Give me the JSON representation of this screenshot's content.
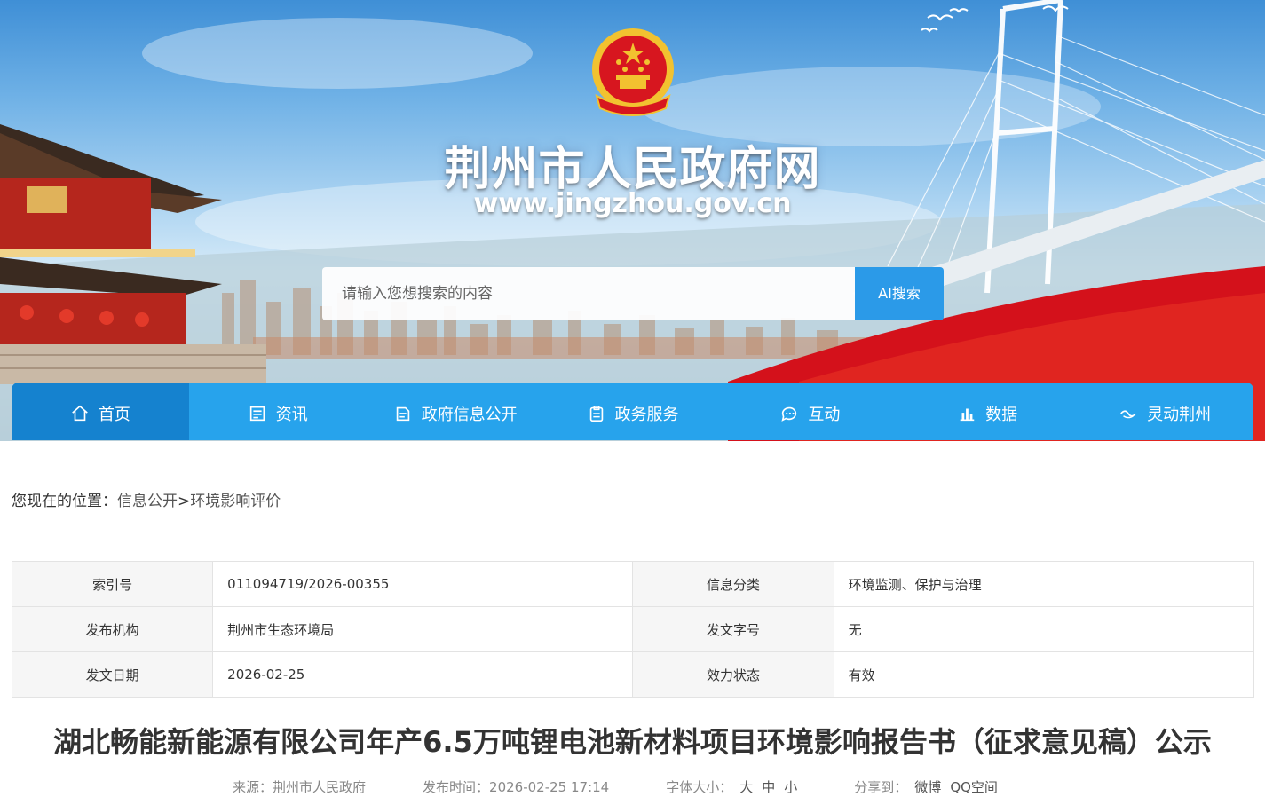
{
  "colors": {
    "nav_bg": "#27a3ec",
    "nav_active": "#1582cf",
    "search_button": "#2b9ae8",
    "emblem_red": "#d7161f",
    "emblem_gold": "#f2c230"
  },
  "banner": {
    "title": "荆州市人民政府网",
    "url": "www.jingzhou.gov.cn",
    "search_placeholder": "请输入您想搜索的内容",
    "search_button": "AI搜索"
  },
  "nav": {
    "items": [
      {
        "label": "首页",
        "icon": "home-icon",
        "active": true
      },
      {
        "label": "资讯",
        "icon": "news-icon",
        "active": false
      },
      {
        "label": "政府信息公开",
        "icon": "info-disclosure-icon",
        "active": false
      },
      {
        "label": "政务服务",
        "icon": "clipboard-icon",
        "active": false
      },
      {
        "label": "互动",
        "icon": "chat-icon",
        "active": false
      },
      {
        "label": "数据",
        "icon": "bar-chart-icon",
        "active": false
      },
      {
        "label": "灵动荆州",
        "icon": "wave-icon",
        "active": false
      }
    ]
  },
  "breadcrumb": {
    "prefix": "您现在的位置：",
    "items": [
      "信息公开",
      "环境影响评价"
    ],
    "separator": ">"
  },
  "info": {
    "rows": [
      {
        "label1": "索引号",
        "value1": "011094719/2026-00355",
        "label2": "信息分类",
        "value2": "环境监测、保护与治理"
      },
      {
        "label1": "发布机构",
        "value1": "荆州市生态环境局",
        "label2": "发文字号",
        "value2": "无"
      },
      {
        "label1": "发文日期",
        "value1": "2026-02-25",
        "label2": "效力状态",
        "value2": "有效"
      }
    ]
  },
  "article": {
    "title": "湖北畅能新能源有限公司年产6.5万吨锂电池新材料项目环境影响报告书（征求意见稿）公示",
    "source_label": "来源：",
    "source": "荆州市人民政府",
    "publish_label": "发布时间：",
    "publish_time": "2026-02-25 17:14",
    "font_size_label": "字体大小：",
    "font_sizes": [
      "大",
      "中",
      "小"
    ],
    "share_label": "分享到：",
    "share_targets": [
      "微博",
      "QQ空间"
    ]
  }
}
